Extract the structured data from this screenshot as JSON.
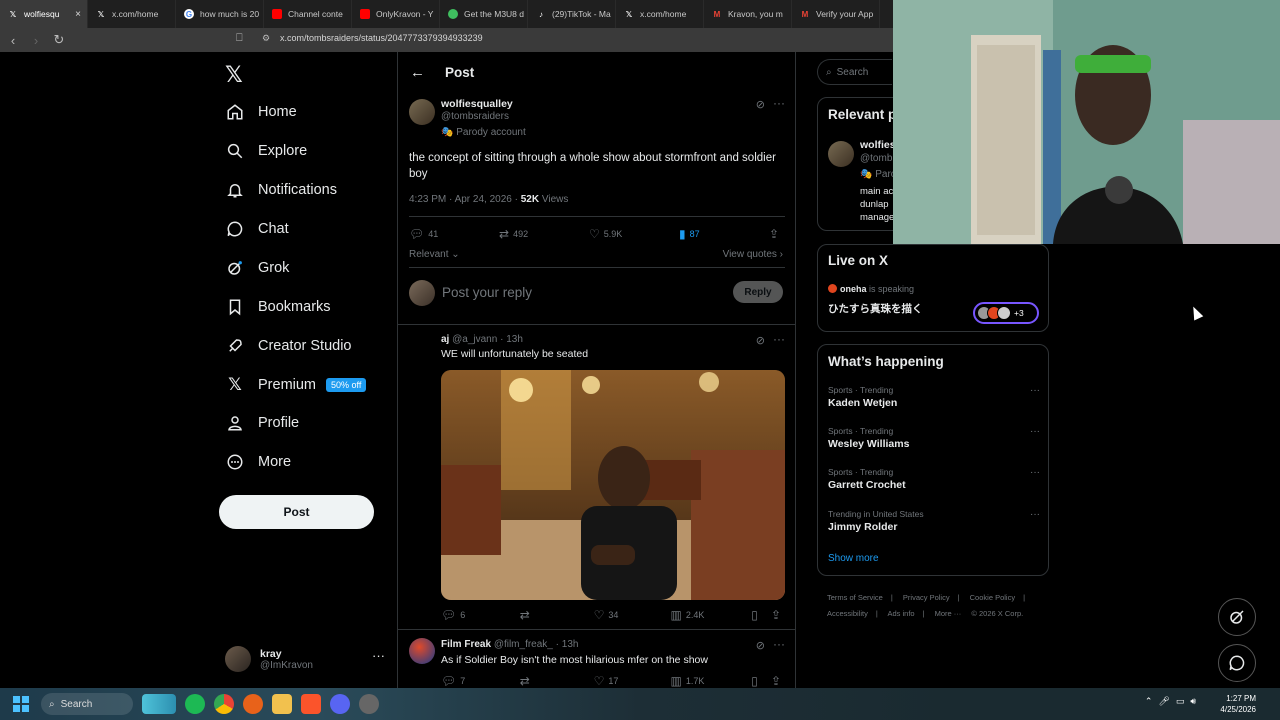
{
  "browser": {
    "tabs": [
      {
        "label": "wolfiesqu",
        "active": true
      },
      {
        "label": "x.com/home"
      },
      {
        "label": "how much is 20"
      },
      {
        "label": "Channel conte"
      },
      {
        "label": "OnlyKravon - Y"
      },
      {
        "label": "Get the M3U8 d"
      },
      {
        "label": "(29)TikTok - Ma"
      },
      {
        "label": "x.com/home"
      },
      {
        "label": "Kravon, you m"
      },
      {
        "label": "Verify your App"
      }
    ],
    "url": "x.com/tombsraiders/status/2047773379394933239"
  },
  "nav": {
    "items": [
      {
        "label": "Home",
        "icon": "home-icon"
      },
      {
        "label": "Explore",
        "icon": "search-icon"
      },
      {
        "label": "Notifications",
        "icon": "bell-icon"
      },
      {
        "label": "Chat",
        "icon": "chat-icon"
      },
      {
        "label": "Grok",
        "icon": "grok-icon"
      },
      {
        "label": "Bookmarks",
        "icon": "bookmark-icon"
      },
      {
        "label": "Creator Studio",
        "icon": "rocket-icon"
      },
      {
        "label": "Premium",
        "icon": "x-icon"
      },
      {
        "label": "Profile",
        "icon": "person-icon"
      },
      {
        "label": "More",
        "icon": "more-circle-icon"
      }
    ],
    "premium_badge": "50% off",
    "post_label": "Post",
    "account": {
      "name": "kray",
      "handle": "@ImKravon"
    }
  },
  "main": {
    "header_title": "Post",
    "post": {
      "name": "wolfiesqualley",
      "handle": "@tombsraiders",
      "parody": "Parody account",
      "text": "the concept of sitting through a whole show about stormfront and soldier boy",
      "time": "4:23 PM · Apr 24, 2026 · ",
      "views_count": "52K",
      "views_label": " Views",
      "replies": "41",
      "reposts": "492",
      "likes": "5.9K",
      "bookmarks": "87"
    },
    "sort_label": "Relevant",
    "view_quotes": "View quotes",
    "reply_placeholder": "Post your reply",
    "reply_button": "Reply",
    "replies": [
      {
        "name": "aj",
        "meta": "@a_jvann · 13h",
        "text": "WE will unfortunately be seated",
        "comments": "6",
        "reposts": "",
        "likes": "34",
        "views": "2.4K"
      },
      {
        "name": "Film Freak",
        "meta": "@film_freak_ · 13h",
        "text": "As if Soldier Boy isn't the most hilarious mfer on the show",
        "comments": "7",
        "reposts": "",
        "likes": "17",
        "views": "1.7K"
      }
    ]
  },
  "sidebar": {
    "search_placeholder": "Search",
    "relevant_title": "Relevant p",
    "relevant_person": {
      "name": "wolfies",
      "handle": "@tomb",
      "parody": "Paro",
      "bio": [
        "main ac",
        "dunlap",
        "manage"
      ]
    },
    "live_title": "Live on X",
    "live_host": "oneha",
    "live_speaking": " is speaking",
    "live_text": "ひたすら真珠を描く",
    "live_extra": "+3",
    "happening_title": "What’s happening",
    "trends": [
      {
        "category": "Sports · Trending",
        "name": "Kaden Wetjen"
      },
      {
        "category": "Sports · Trending",
        "name": "Wesley Williams"
      },
      {
        "category": "Sports · Trending",
        "name": "Garrett Crochet"
      },
      {
        "category": "Trending in United States",
        "name": "Jimmy Rolder"
      }
    ],
    "show_more": "Show more",
    "footer": [
      "Terms of Service",
      "|",
      "Privacy Policy",
      "|",
      "Cookie Policy",
      "|",
      "Accessibility",
      "|",
      "Ads info",
      "|",
      "More ···",
      "© 2026 X Corp."
    ]
  },
  "taskbar": {
    "search": "Search",
    "time": "1:27 PM",
    "date": "4/25/2026"
  },
  "colors": {
    "accent": "#1d9bf0",
    "bg": "#000000",
    "muted": "#71767b",
    "bookmark_active": "#1d9bf0"
  }
}
